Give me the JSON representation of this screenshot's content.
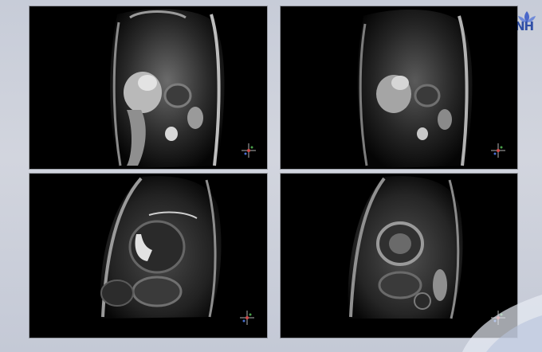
{
  "slide": {
    "logo_text": "NH",
    "panels": [
      {
        "name": "mri-panel-top-left",
        "view": "cardiac-mri-coronal"
      },
      {
        "name": "mri-panel-top-right",
        "view": "cardiac-mri-coronal"
      },
      {
        "name": "mri-panel-bottom-left",
        "view": "cardiac-mri-short-axis"
      },
      {
        "name": "mri-panel-bottom-right",
        "view": "cardiac-mri-short-axis"
      }
    ]
  },
  "icons": {
    "logo": "lotus-logo-icon",
    "orientation": "orientation-compass-icon"
  },
  "colors": {
    "background": "#c9cdd9",
    "logo": "#2f4fa6",
    "panel": "#000000"
  }
}
